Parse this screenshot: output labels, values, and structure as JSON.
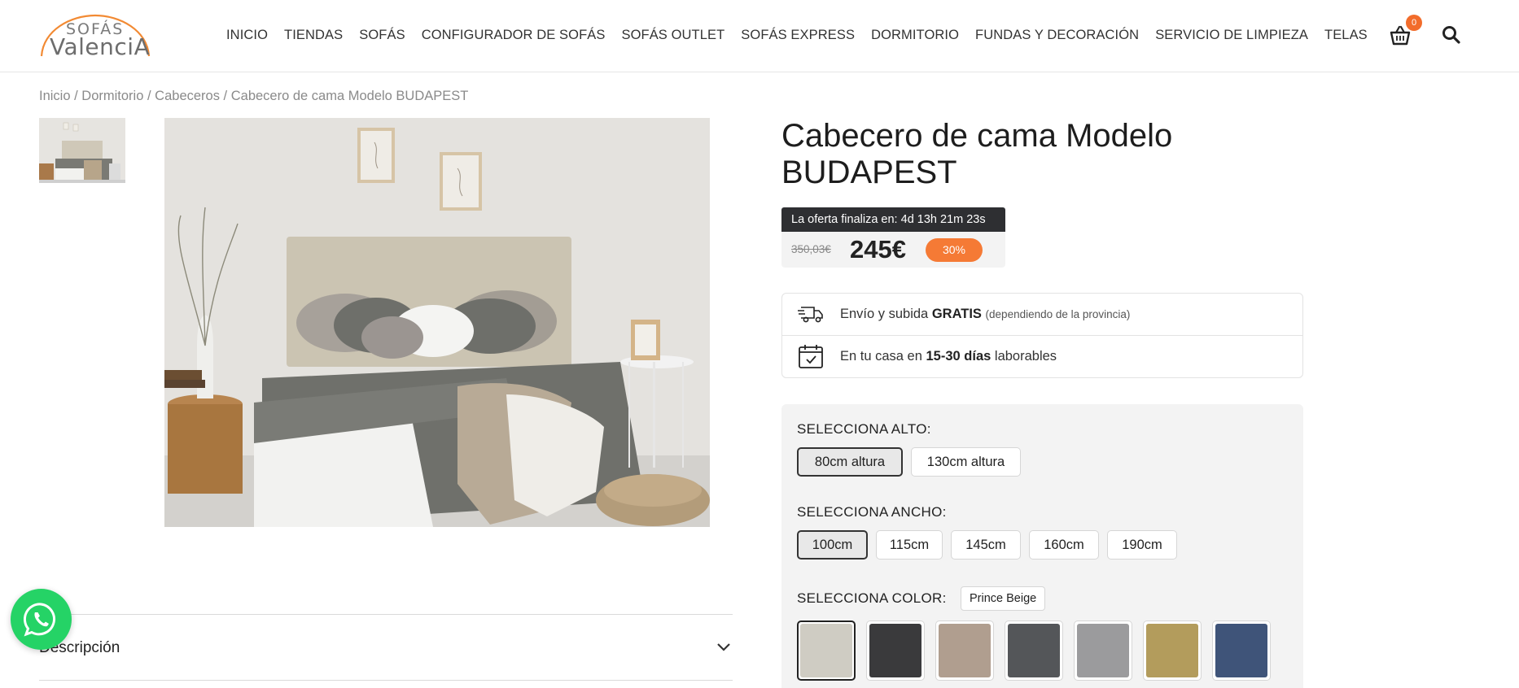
{
  "header": {
    "logo_line1": "SOFÁS",
    "logo_line2": "ValenciA",
    "nav": [
      "INICIO",
      "TIENDAS",
      "SOFÁS",
      "CONFIGURADOR DE SOFÁS",
      "SOFÁS OUTLET",
      "SOFÁS EXPRESS",
      "DORMITORIO",
      "FUNDAS Y DECORACIÓN",
      "SERVICIO DE LIMPIEZA",
      "TELAS"
    ],
    "cart_count": "0",
    "cart_icon": "basket-icon",
    "search_icon": "search-icon"
  },
  "breadcrumb": {
    "items": [
      "Inicio",
      "Dormitorio",
      "Cabeceros",
      "Cabecero de cama Modelo BUDAPEST"
    ],
    "separator": " / "
  },
  "product": {
    "title": "Cabecero de cama Modelo BUDAPEST",
    "offer_prefix": "La oferta finaliza en:",
    "offer_countdown": "4d 13h 21m 23s",
    "old_price": "350,03€",
    "price": "245€",
    "discount": "30%",
    "shipping_pre": "Envío y subida ",
    "shipping_bold": "GRATIS",
    "shipping_note": "(dependiendo de la provincia)",
    "delivery_pre": "En tu casa en ",
    "delivery_bold": "15-30 días",
    "delivery_post": " laborables"
  },
  "options": {
    "height_label": "SELECCIONA ALTO:",
    "heights": [
      "80cm altura",
      "130cm altura"
    ],
    "height_selected": 0,
    "width_label": "SELECCIONA ANCHO:",
    "widths": [
      "100cm",
      "115cm",
      "145cm",
      "160cm",
      "190cm"
    ],
    "width_selected": 0,
    "color_label": "SELECCIONA COLOR:",
    "color_name": "Prince Beige",
    "colors": [
      "#cfccc3",
      "#3a3a3c",
      "#b09e8f",
      "#545659",
      "#9b9b9d",
      "#b39c5c",
      "#3f5479"
    ],
    "color_selected": 0
  },
  "description": {
    "label": "Descripción"
  },
  "whatsapp_icon": "whatsapp-icon"
}
